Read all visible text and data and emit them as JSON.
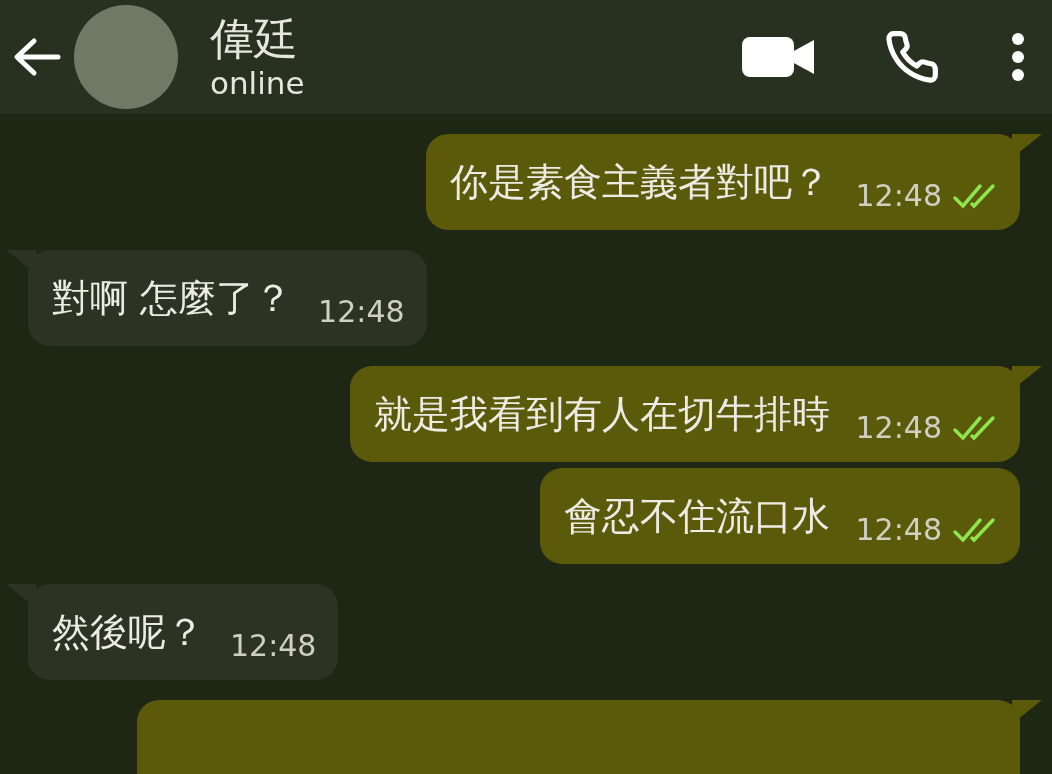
{
  "header": {
    "name": "偉廷",
    "status": "online"
  },
  "messages": [
    {
      "kind": "sent",
      "tail": true,
      "text": "你是素食主義者對吧？",
      "time": "12:48",
      "read": true
    },
    {
      "kind": "received",
      "tail": true,
      "text": "對啊 怎麼了？",
      "time": "12:48"
    },
    {
      "kind": "sent",
      "tail": true,
      "text": "就是我看到有人在切牛排時",
      "time": "12:48",
      "read": true
    },
    {
      "kind": "sent",
      "tail": false,
      "text": "會忍不住流口水",
      "time": "12:48",
      "read": true
    },
    {
      "kind": "received",
      "tail": true,
      "text": "然後呢？",
      "time": "12:48"
    },
    {
      "kind": "sent",
      "tail": true
    }
  ]
}
